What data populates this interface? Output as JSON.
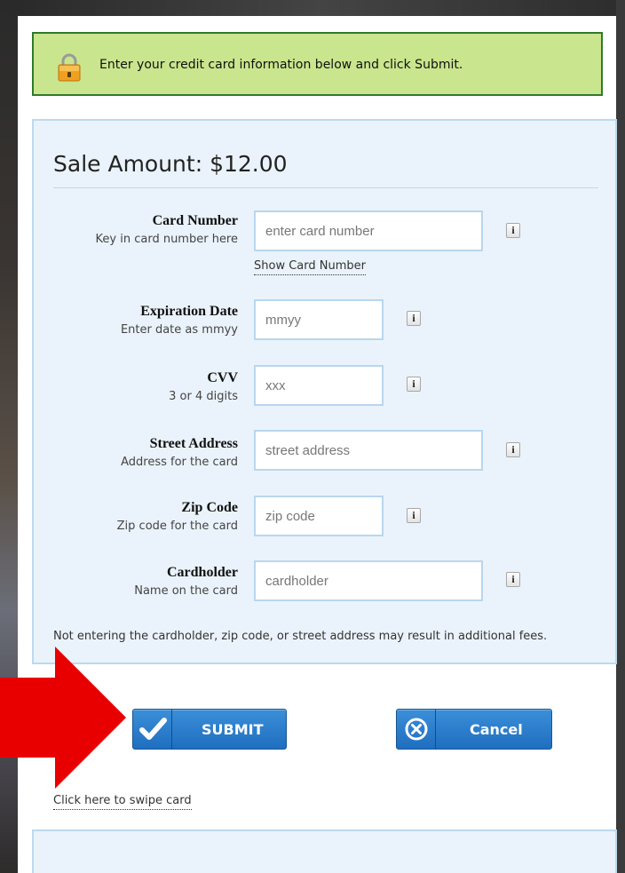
{
  "notice": {
    "text": "Enter your credit card information below and click Submit."
  },
  "form": {
    "heading": "Sale Amount: $12.00",
    "fields": {
      "card_number": {
        "label": "Card Number",
        "sublabel": "Key in card number here",
        "placeholder": "enter card number"
      },
      "expiration": {
        "label": "Expiration Date",
        "sublabel": "Enter date as mmyy",
        "placeholder": "mmyy"
      },
      "cvv": {
        "label": "CVV",
        "sublabel": "3 or 4 digits",
        "placeholder": "xxx"
      },
      "street": {
        "label": "Street Address",
        "sublabel": "Address for the card",
        "placeholder": "street address"
      },
      "zip": {
        "label": "Zip Code",
        "sublabel": "Zip code for the card",
        "placeholder": "zip code"
      },
      "cardholder": {
        "label": "Cardholder",
        "sublabel": "Name on the card",
        "placeholder": "cardholder"
      }
    },
    "info_glyph": "i",
    "show_card_link": "Show Card Number",
    "fee_note": "Not entering the cardholder, zip code, or street address may result in additional fees.",
    "submit_label": "SUBMIT",
    "cancel_label": "Cancel",
    "swipe_link": "Click here to swipe card"
  },
  "colors": {
    "notice_bg": "#c9e58d",
    "notice_border": "#2f7a2b",
    "panel_bg": "#eaf3fb",
    "button_blue": "#2a7fcf",
    "arrow_red": "#e80000"
  },
  "icons": {
    "notice": "padlock-icon",
    "submit": "checkmark-icon",
    "cancel": "circle-x-icon",
    "pointer": "red-arrow-icon"
  }
}
